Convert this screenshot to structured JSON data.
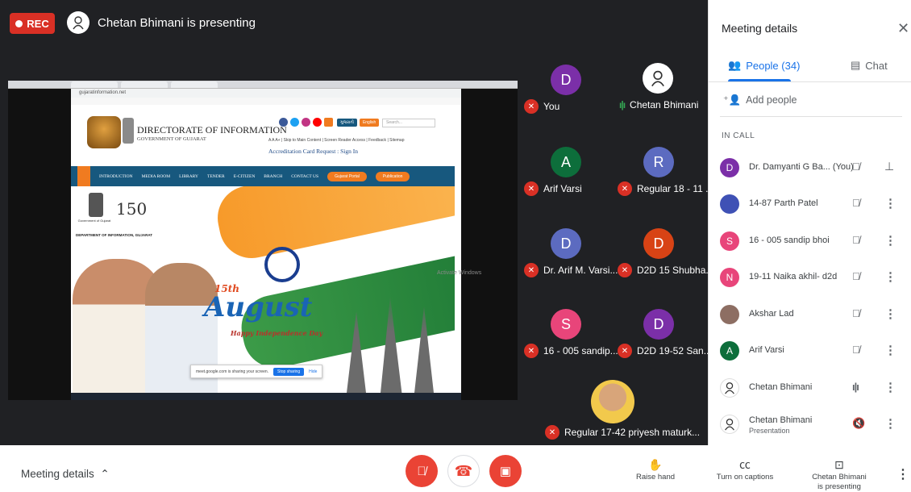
{
  "header": {
    "rec_label": "REC",
    "presenter_text": "Chetan Bhimani is presenting"
  },
  "shared_screen": {
    "site_title": "DIRECTORATE OF INFORMATION",
    "site_subtitle": "GOVERNMENT OF GUJARAT",
    "address": "gujaratinformation.net",
    "language_buttons": [
      "ગુજરાતી",
      "English"
    ],
    "search_placeholder": "Search...",
    "accessibility_links": "A  A  A+  |  Skip to Main Content  |  Screen Reader Access  |  Feedback  |  Sitemap",
    "accreditation": "Accreditation Card Request : Sign In",
    "nav_items": [
      "INTRODUCTION",
      "MEDIA ROOM",
      "LIBRARY",
      "TENDER",
      "E-CITIZEN",
      "BRANCH",
      "CONTACT US"
    ],
    "nav_pills": [
      "Gujarat Portal",
      "Publication"
    ],
    "gov_label": "Government of Gujarat",
    "anniversary": "150",
    "department": "DEPARTMENT OF INFORMATION, GUJARAT",
    "banner_date": "15th",
    "banner_word": "August",
    "banner_sub": "Happy Independence Day",
    "share_notice": "meet.google.com is sharing your screen.",
    "share_stop": "Stop sharing",
    "share_hide": "Hide",
    "activate_text": "Activate Windows"
  },
  "tiles": [
    {
      "initial": "D",
      "color": "#7b2fa8",
      "name": "You",
      "status": "muted"
    },
    {
      "initial": "",
      "color": "#ffffff",
      "name": "Chetan Bhimani",
      "status": "talking"
    },
    {
      "initial": "A",
      "color": "#0d6e3b",
      "name": "Arif Varsi",
      "status": "muted"
    },
    {
      "initial": "R",
      "color": "#5c6bc0",
      "name": "Regular 18 - 11 ...",
      "status": "muted"
    },
    {
      "initial": "D",
      "color": "#5c6bc0",
      "name": "Dr. Arif M. Varsi...",
      "status": "muted"
    },
    {
      "initial": "D",
      "color": "#d84315",
      "name": "D2D 15 Shubha...",
      "status": "muted"
    },
    {
      "initial": "S",
      "color": "#e8457a",
      "name": "16 - 005 sandip...",
      "status": "muted"
    },
    {
      "initial": "D",
      "color": "#7b2fa8",
      "name": "D2D 19-52 San...",
      "status": "muted"
    },
    {
      "initial": "",
      "color": "#f2c94c",
      "name": "Regular 17-42 priyesh maturk...",
      "status": "muted"
    }
  ],
  "panel": {
    "title": "Meeting details",
    "tab_people": "People (34)",
    "tab_chat": "Chat",
    "add_people": "Add people",
    "in_call_label": "IN CALL",
    "people": [
      {
        "initial": "D",
        "color": "#7b2fa8",
        "name": "Dr. Damyanti G Ba... (You)",
        "sub": "",
        "status": "muted-pin"
      },
      {
        "initial": "",
        "color": "#3f51b5",
        "name": "14-87 Parth Patel",
        "sub": "",
        "status": "muted"
      },
      {
        "initial": "S",
        "color": "#e8457a",
        "name": "16 - 005 sandip bhoi",
        "sub": "",
        "status": "muted"
      },
      {
        "initial": "N",
        "color": "#e8457a",
        "name": "19-11 Naika akhil- d2d",
        "sub": "",
        "status": "muted"
      },
      {
        "initial": "",
        "color": "#8d6e63",
        "name": "Akshar Lad",
        "sub": "",
        "status": "muted"
      },
      {
        "initial": "A",
        "color": "#0d6e3b",
        "name": "Arif Varsi",
        "sub": "",
        "status": "muted"
      },
      {
        "initial": "",
        "color": "#ffffff",
        "name": "Chetan Bhimani",
        "sub": "",
        "status": "talking"
      },
      {
        "initial": "",
        "color": "#ffffff",
        "name": "Chetan Bhimani",
        "sub": "Presentation",
        "status": "muted"
      }
    ]
  },
  "bottom_bar": {
    "details_label": "Meeting details",
    "raise_hand": "Raise hand",
    "captions": "Turn on captions",
    "presenting_line1": "Chetan Bhimani",
    "presenting_line2": "is presenting"
  },
  "colors": {
    "stage_bg": "#202124",
    "rec_red": "#d93025",
    "accent_blue": "#1a73e8",
    "talking_green": "#34a853"
  }
}
